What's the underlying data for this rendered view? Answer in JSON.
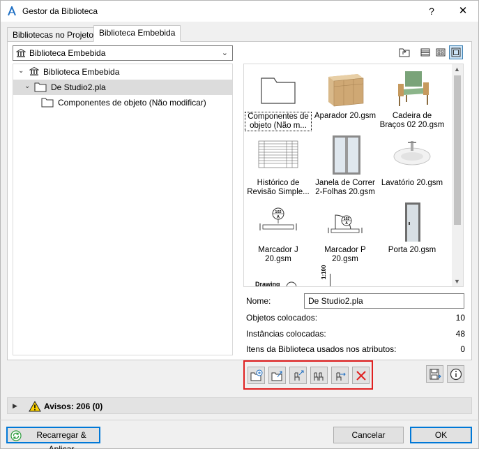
{
  "window": {
    "title": "Gestor da Biblioteca",
    "help_label": "?",
    "close_label": "✕"
  },
  "tabs": [
    {
      "label": "Bibliotecas no Projeto",
      "active": false
    },
    {
      "label": "Biblioteca Embebida",
      "active": true
    }
  ],
  "library_combo": {
    "value": "Biblioteca Embebida"
  },
  "tree": [
    {
      "label": "Biblioteca Embebida",
      "level": 0,
      "expanded": true,
      "icon": "library-icon",
      "selected": false
    },
    {
      "label": "De Studio2.pla",
      "level": 1,
      "expanded": true,
      "icon": "folder-icon",
      "selected": true
    },
    {
      "label": "Componentes de objeto (Não modificar)",
      "level": 2,
      "expanded": false,
      "icon": "folder-icon",
      "selected": false
    }
  ],
  "grid_items": [
    {
      "label_line1": "Componentes de",
      "label_line2": "objeto (Não m...",
      "thumb": "folder-thumb",
      "focus": true
    },
    {
      "label_line1": "Aparador 20.gsm",
      "label_line2": "",
      "thumb": "sideboard-thumb",
      "focus": false
    },
    {
      "label_line1": "Cadeira de",
      "label_line2": "Braços 02 20.gsm",
      "thumb": "armchair-thumb",
      "focus": false
    },
    {
      "label_line1": "Histórico de",
      "label_line2": "Revisão Simple...",
      "thumb": "table-thumb",
      "focus": false
    },
    {
      "label_line1": "Janela de Correr",
      "label_line2": "2-Folhas 20.gsm",
      "thumb": "window-thumb",
      "focus": false
    },
    {
      "label_line1": "Lavatório 20.gsm",
      "label_line2": "",
      "thumb": "sink-thumb",
      "focus": false
    },
    {
      "label_line1": "Marcador J",
      "label_line2": "20.gsm",
      "thumb": "marker-j-thumb",
      "focus": false
    },
    {
      "label_line1": "Marcador P",
      "label_line2": "20.gsm",
      "thumb": "marker-p-thumb",
      "focus": false
    },
    {
      "label_line1": "Porta 20.gsm",
      "label_line2": "",
      "thumb": "door-thumb",
      "focus": false
    }
  ],
  "partial_items": {
    "drawing_label": "Drawing",
    "scale_label": "1:100"
  },
  "props": {
    "name_label": "Nome:",
    "name_value": "De Studio2.pla",
    "placed_objects_label": "Objetos colocados:",
    "placed_objects_value": "10",
    "placed_instances_label": "Instâncias colocadas:",
    "placed_instances_value": "48",
    "attribute_items_label": "Itens da Biblioteca usados nos atributos:",
    "attribute_items_value": "0"
  },
  "warnings": {
    "label": "Avisos: 206 (0)"
  },
  "footer": {
    "reload_label": "Recarregar & Aplicar",
    "cancel_label": "Cancelar",
    "ok_label": "OK"
  },
  "colors": {
    "accent": "#0078d7",
    "highlight_border": "#e02020",
    "delete_red": "#e02020"
  }
}
